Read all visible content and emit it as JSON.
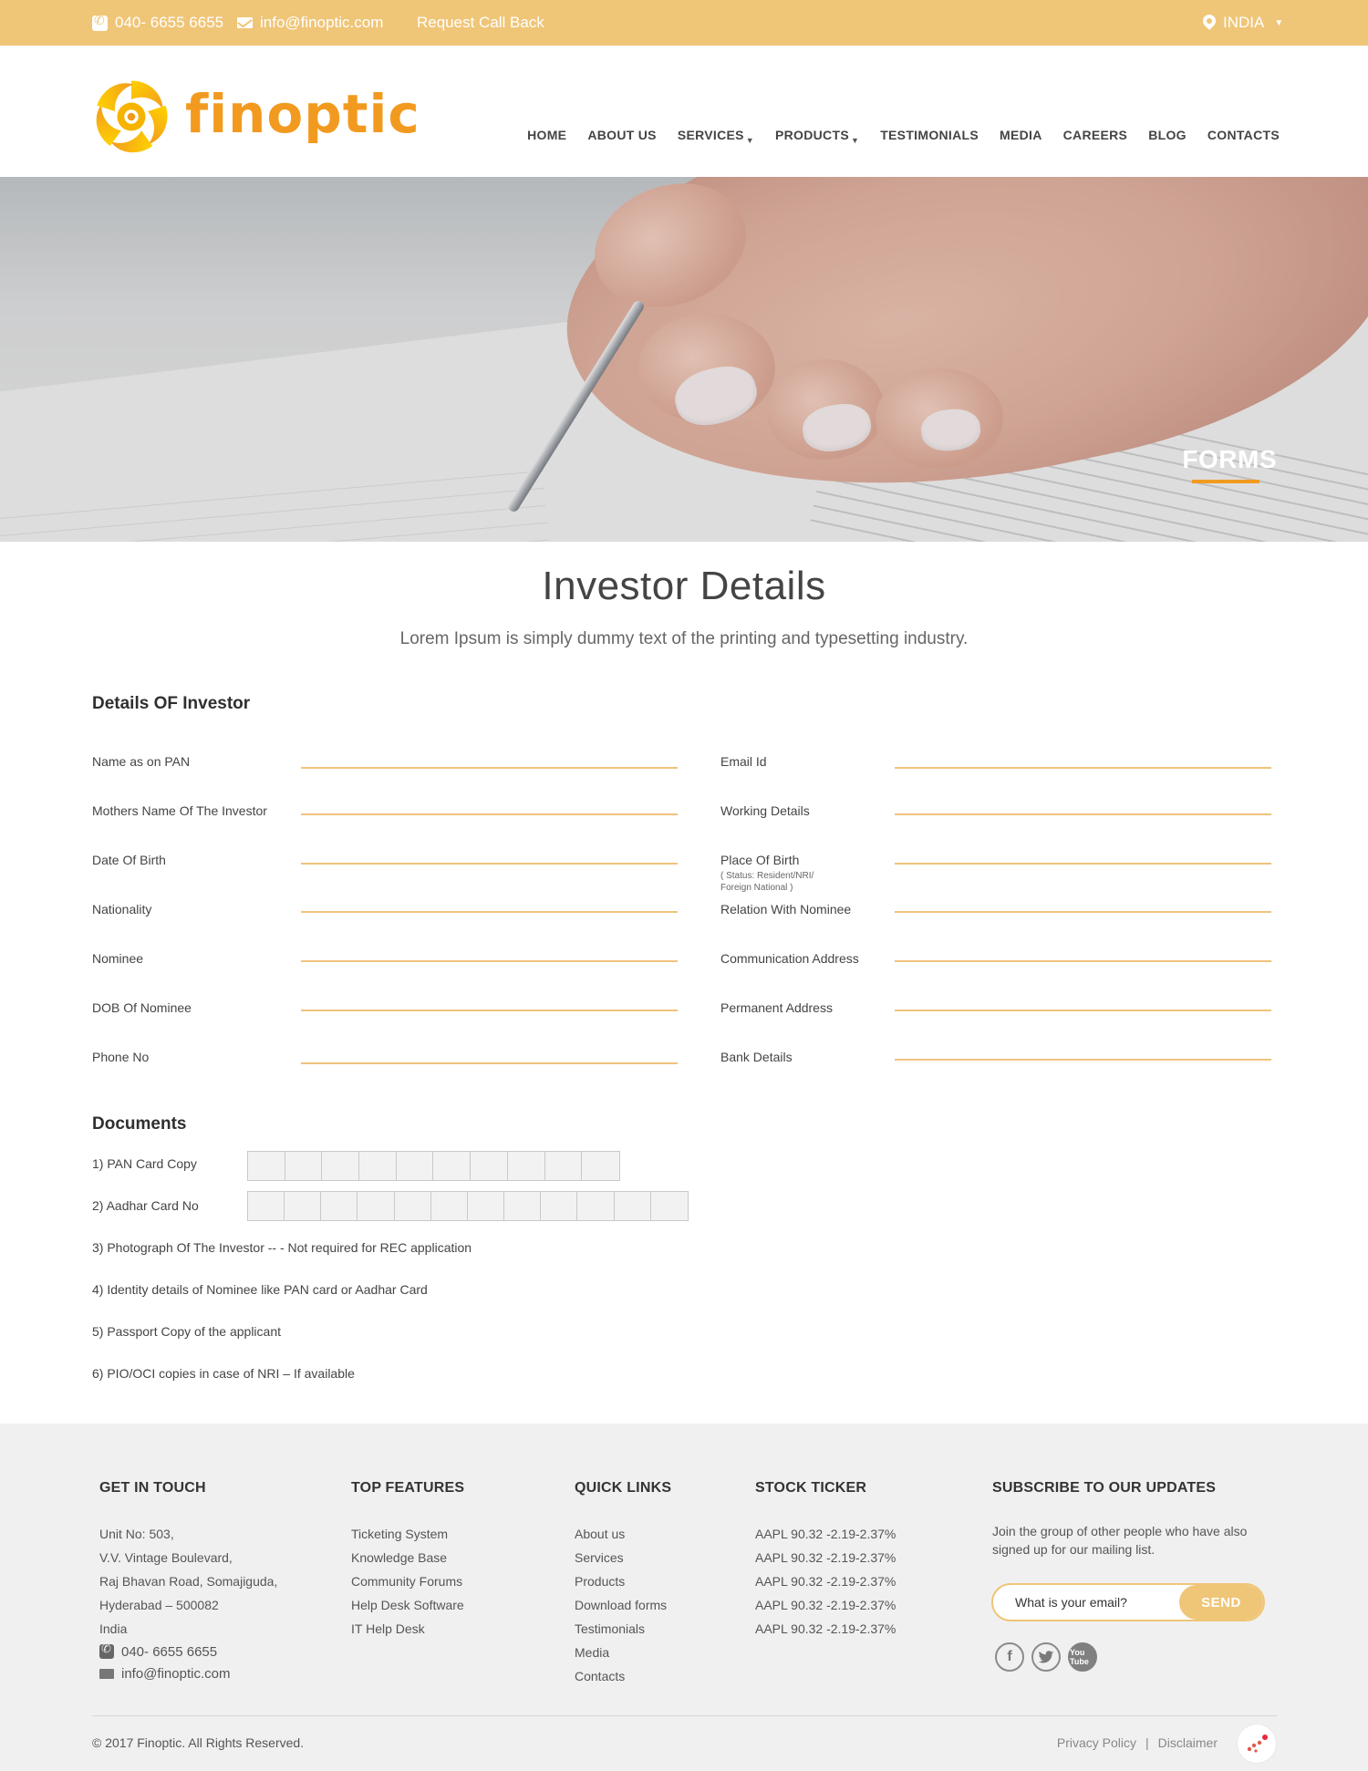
{
  "topbar": {
    "phone": "040- 6655 6655",
    "email": "info@finoptic.com",
    "callback": "Request Call Back",
    "country": "INDIA",
    "bg_color": "#efc577"
  },
  "brand": {
    "name": "finoptic",
    "color": "#f29a1f"
  },
  "nav": [
    {
      "label": "HOME"
    },
    {
      "label": "ABOUT US"
    },
    {
      "label": "SERVICES"
    },
    {
      "label": "PRODUCTS"
    },
    {
      "label": "TESTIMONIALS"
    },
    {
      "label": "MEDIA"
    },
    {
      "label": "CAREERS"
    },
    {
      "label": "BLOG"
    },
    {
      "label": "CONTACTS"
    }
  ],
  "banner": {
    "title": "FORMS"
  },
  "intro": {
    "title": "Investor Details",
    "subtitle": "Lorem Ipsum is simply dummy text of the printing and typesetting industry."
  },
  "investor": {
    "heading": "Details OF Investor",
    "left_fields": [
      "Name as on PAN",
      "Mothers Name Of The Investor",
      "Date Of Birth",
      "Nationality",
      "Nominee",
      "DOB Of Nominee",
      "Phone No"
    ],
    "right_fields": [
      "Email Id",
      "Working Details",
      "Place Of Birth",
      "Relation With Nominee",
      "Communication Address",
      "Permanent Address",
      "Bank Details"
    ],
    "place_of_birth_note_1": "( Status: Resident/NRI/",
    "place_of_birth_note_2": "Foreign National )"
  },
  "documents": {
    "heading": "Documents",
    "pan_label": "1) PAN Card Copy",
    "aadhar_label": "2) Aadhar Card No",
    "pan_boxes": 10,
    "aadhar_boxes": 12,
    "items": [
      "3) Photograph Of The Investor -- - Not required for REC application",
      "4) Identity details of Nominee like PAN card or Aadhar Card",
      "5) Passport Copy of the applicant",
      "6) PIO/OCI copies in case of NRI – If available"
    ]
  },
  "footer": {
    "get_in_touch": {
      "title": "GET IN TOUCH",
      "address": [
        "Unit No: 503,",
        "V.V. Vintage Boulevard,",
        "Raj Bhavan Road, Somajiguda,",
        "Hyderabad – 500082",
        "India"
      ],
      "phone": "040- 6655 6655",
      "email": "info@finoptic.com"
    },
    "top_features": {
      "title": "TOP FEATURES",
      "items": [
        "Ticketing System",
        "Knowledge Base",
        "Community Forums",
        "Help Desk Software",
        "IT Help Desk"
      ]
    },
    "quick_links": {
      "title": "QUICK LINKS",
      "items": [
        "About us",
        "Services",
        "Products",
        "Download forms",
        "Testimonials",
        "Media",
        "Contacts"
      ]
    },
    "stock_ticker": {
      "title": "STOCK TICKER",
      "items": [
        "AAPL 90.32 -2.19-2.37%",
        "AAPL 90.32 -2.19-2.37%",
        "AAPL 90.32 -2.19-2.37%",
        "AAPL 90.32 -2.19-2.37%",
        "AAPL 90.32 -2.19-2.37%"
      ]
    },
    "subscribe": {
      "title": "SUBSCRIBE TO OUR UPDATES",
      "text": "Join the group of other people who have also signed up for our mailing list.",
      "placeholder": "What is your email?",
      "button": "SEND"
    },
    "social": [
      "facebook-icon",
      "twitter-icon",
      "youtube-icon"
    ],
    "youtube_text": "You Tube",
    "copyright": "© 2017 Finoptic. All Rights Reserved.",
    "privacy": "Privacy Policy",
    "separator": "|",
    "disclaimer": "Disclaimer"
  }
}
